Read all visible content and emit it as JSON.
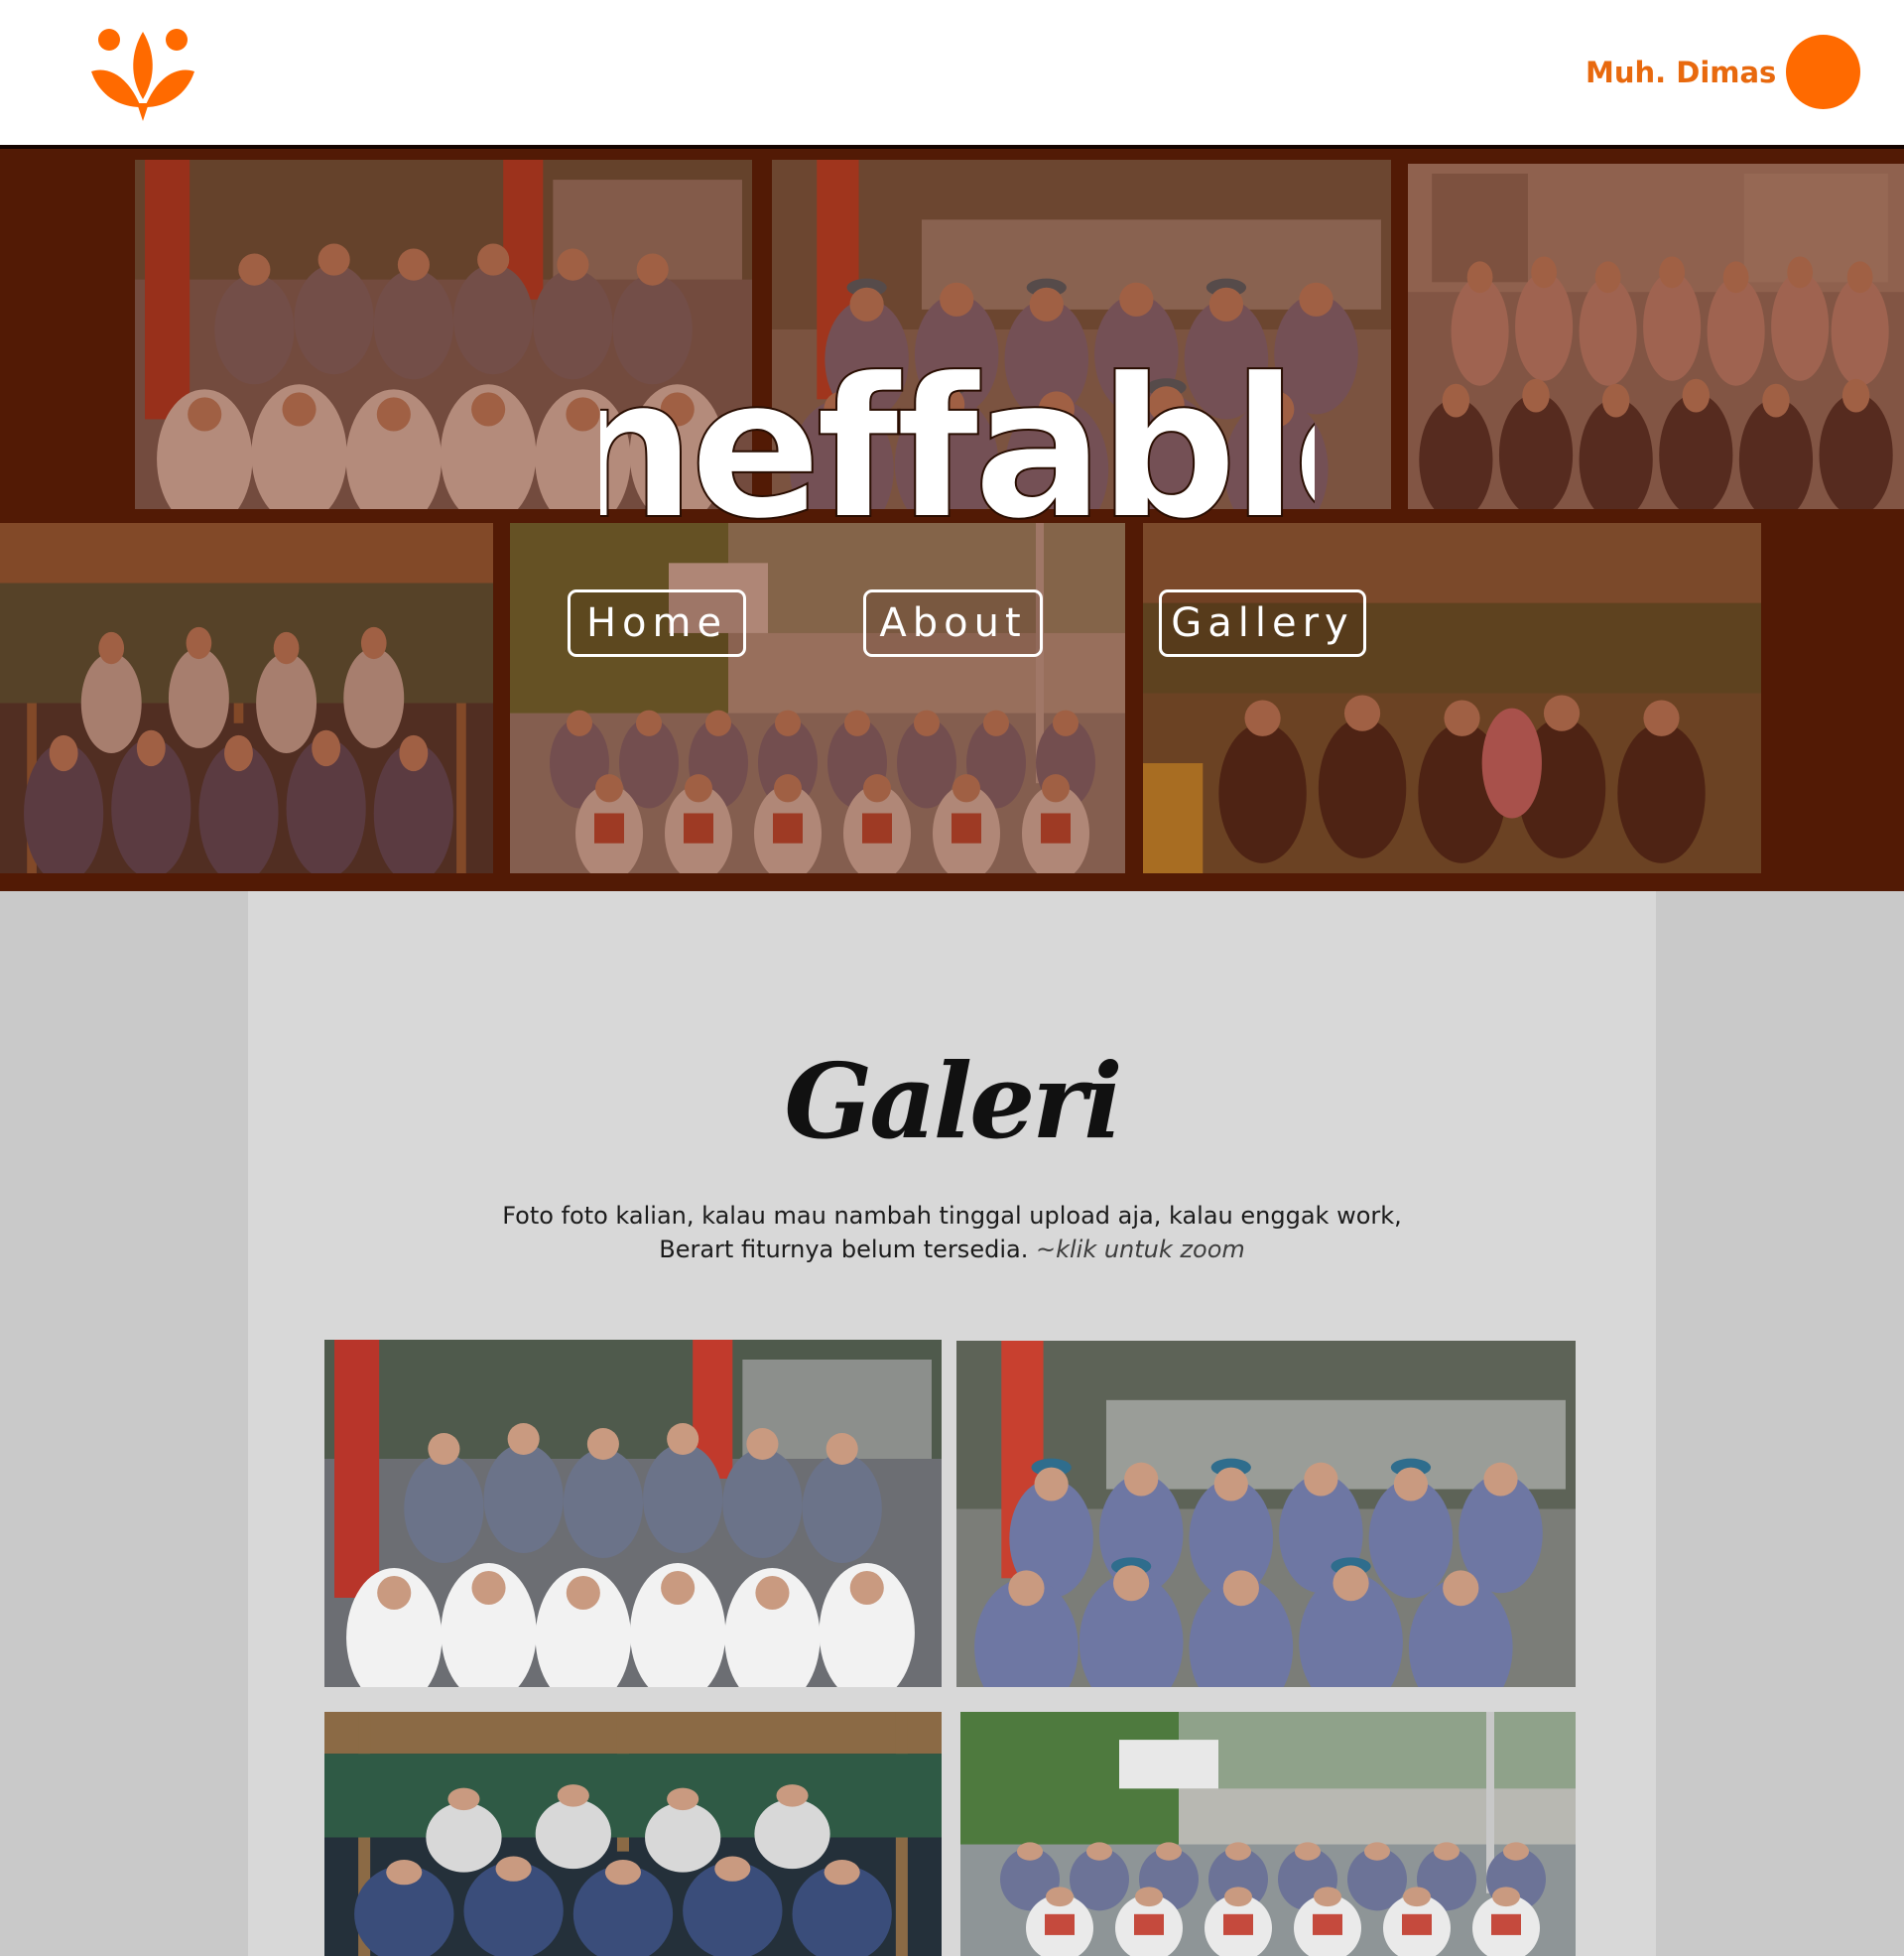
{
  "header": {
    "user_name": "Muh. Dimas"
  },
  "hero": {
    "title": "ineffable",
    "nav": [
      {
        "label": "Home"
      },
      {
        "label": "About"
      },
      {
        "label": "Gallery"
      }
    ]
  },
  "gallery": {
    "title": "Galeri",
    "description_line1": "Foto foto kalian, kalau mau nambah tinggal upload aja, kalau enggak work,",
    "description_line2": "Berart fiturnya belum tersedia.",
    "description_hint": "~klik untuk zoom"
  },
  "colors": {
    "brand_orange": "#ff6a00",
    "user_name": "#e8690e",
    "hero_background": "#521a05",
    "page_background": "#c9c9c9",
    "panel_background": "#d8d8d8"
  },
  "icons": {
    "logo": "lotus-flower-logo",
    "avatar": "user-avatar-circle"
  }
}
